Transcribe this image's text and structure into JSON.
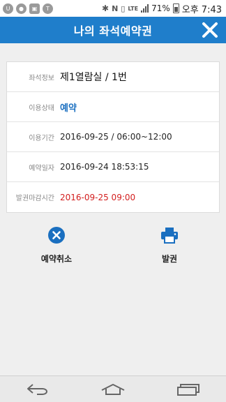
{
  "status_bar": {
    "battery": "71%",
    "time": "오후 7:43"
  },
  "header": {
    "title": "나의 좌석예약권"
  },
  "details": [
    {
      "label": "좌석정보",
      "value": "제1열람실 / 1번"
    },
    {
      "label": "이용상태",
      "value": "예약"
    },
    {
      "label": "이용기간",
      "value": "2016-09-25 / 06:00~12:00"
    },
    {
      "label": "예약일자",
      "value": "2016-09-24 18:53:15"
    },
    {
      "label": "발권마감시간",
      "value": "2016-09-25 09:00"
    }
  ],
  "actions": {
    "cancel_label": "예약취소",
    "issue_label": "발권"
  },
  "colors": {
    "header_bg": "#1f7ecb",
    "status_reserved": "#1a6fc0",
    "deadline": "#d31e1e"
  }
}
